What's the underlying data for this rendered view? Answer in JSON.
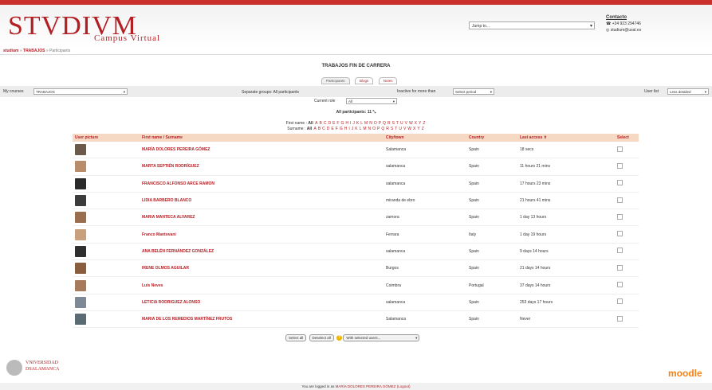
{
  "header": {
    "logo_text": "STVDIVM",
    "logo_sub": "Campus Virtual",
    "jump_placeholder": "Jump to...",
    "contact_title": "Contacto",
    "contact_phone": "+34 923 294746",
    "contact_email": "studium@usal.es"
  },
  "breadcrumb": {
    "root": "studium",
    "sep1": "»",
    "course": "TRABAJOS",
    "sep2": "»",
    "current": "Participants"
  },
  "page_title": "TRABAJOS FIN DE CARRERA",
  "tabs": [
    {
      "label": "Participants"
    },
    {
      "label": "Blogs"
    },
    {
      "label": "Notes"
    }
  ],
  "filters": {
    "my_courses_label": "My courses",
    "my_courses_value": "TRABAJOS",
    "groups_text": "Separate groups: All participants",
    "inactive_label": "Inactive for more than",
    "inactive_value": "Select period",
    "userlist_label": "User list",
    "userlist_value": "Less detailed",
    "role_label": "Current role",
    "role_value": "All"
  },
  "all_participants": "All participants: 11",
  "first_name_label": "First name :",
  "surname_label": "Surname :",
  "all_word": "All",
  "letters": [
    "A",
    "B",
    "C",
    "D",
    "E",
    "F",
    "G",
    "H",
    "I",
    "J",
    "K",
    "L",
    "M",
    "N",
    "O",
    "P",
    "Q",
    "R",
    "S",
    "T",
    "U",
    "V",
    "W",
    "X",
    "Y",
    "Z"
  ],
  "table": {
    "headers": [
      "User picture",
      "First name / Surname",
      "City/town",
      "Country",
      "Last access ⬆",
      "Select"
    ],
    "rows": [
      {
        "name": "MARÍA DOLORES PEREIRA GÓMEZ",
        "city": "Salamanca",
        "country": "Spain",
        "access": "18 secs",
        "color": "#6b5a4a"
      },
      {
        "name": "MARTA SEPTIÉN RODRÍGUEZ",
        "city": "salamanca",
        "country": "Spain",
        "access": "11 hours 21 mins",
        "color": "#b98c6a"
      },
      {
        "name": "FRANCISCO ALFONSO ARCE RAMON",
        "city": "salamanca",
        "country": "Spain",
        "access": "17 hours 23 mins",
        "color": "#2a2a2a"
      },
      {
        "name": "LIDIA BARBERO BLANCO",
        "city": "miranda de ebro",
        "country": "Spain",
        "access": "21 hours 41 mins",
        "color": "#3b3b3b"
      },
      {
        "name": "MARIA MANTECA ALVAREZ",
        "city": "zamora",
        "country": "Spain",
        "access": "1 day 13 hours",
        "color": "#9a6f4f"
      },
      {
        "name": "Franco Mantovani",
        "city": "Ferrara",
        "country": "Italy",
        "access": "1 day 19 hours",
        "color": "#c9a07c"
      },
      {
        "name": "ANA BELÉN FERNÁNDEZ GONZÁLEZ",
        "city": "salamanca",
        "country": "Spain",
        "access": "9 days 14 hours",
        "color": "#2f2f2f"
      },
      {
        "name": "IRENE OLMOS AGUILAR",
        "city": "Burgos",
        "country": "Spain",
        "access": "21 days 14 hours",
        "color": "#8b5d3f"
      },
      {
        "name": "Luis Neves",
        "city": "Coimbra",
        "country": "Portugal",
        "access": "37 days 14 hours",
        "color": "#a67a5a"
      },
      {
        "name": "LETICIA RODRIGUEZ ALONSO",
        "city": "salamanca",
        "country": "Spain",
        "access": "253 days 17 hours",
        "color": "#7d8a95"
      },
      {
        "name": "MARIA DE LOS REMEDIOS MARTÍNEZ FRUTOS",
        "city": "Salamanca",
        "country": "Spain",
        "access": "Never",
        "color": "#5b6b73"
      }
    ]
  },
  "actions": {
    "select_all": "Select all",
    "deselect_all": "Deselect all",
    "with_selected": "With selected users..."
  },
  "footer": {
    "university_line1": "VNIVERSIDAD",
    "university_line2": "DSALAMANCA",
    "logged_prefix": "You are logged in as",
    "logged_user": "MARÍA DOLORES PEREIRA GÓMEZ",
    "logout": "(Logout)",
    "moodle": "moodle"
  }
}
